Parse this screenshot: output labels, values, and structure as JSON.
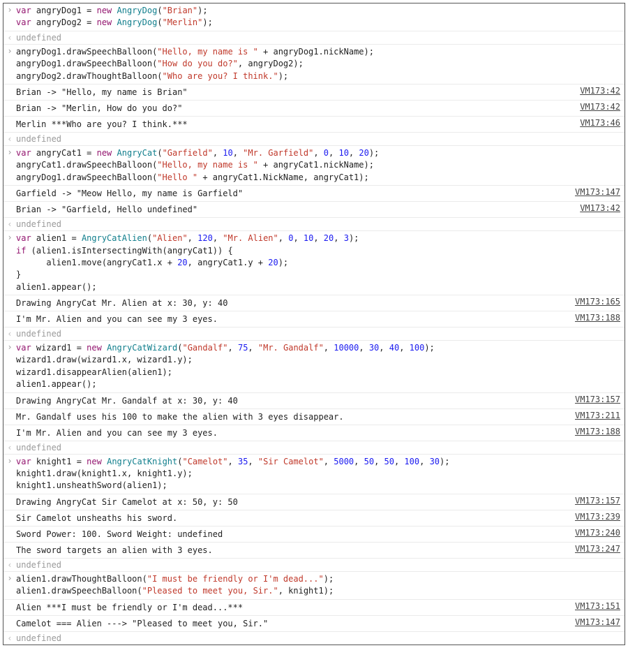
{
  "source": {
    "vm42": "VM173:42",
    "vm46": "VM173:46",
    "vm147": "VM173:147",
    "vm151": "VM173:151",
    "vm157": "VM173:157",
    "vm165": "VM173:165",
    "vm188": "VM173:188",
    "vm211": "VM173:211",
    "vm239": "VM173:239",
    "vm240": "VM173:240",
    "vm247": "VM173:247"
  },
  "undef": "undefined",
  "blk1": {
    "l1a": "var",
    "l1b": " angryDog1 = ",
    "l1c": "new",
    "l1d": " ",
    "l1e": "AngryDog",
    "l1f": "(",
    "l1g": "\"Brian\"",
    "l1h": ");",
    "l2a": "var",
    "l2b": " angryDog2 = ",
    "l2c": "new",
    "l2d": " ",
    "l2e": "AngryDog",
    "l2f": "(",
    "l2g": "\"Merlin\"",
    "l2h": ");"
  },
  "blk2": {
    "l1": "angryDog1.drawSpeechBalloon(",
    "l1s": "\"Hello, my name is \"",
    "l1r": " + angryDog1.nickName);",
    "l2": "angryDog1.drawSpeechBalloon(",
    "l2s": "\"How do you do?\"",
    "l2r": ", angryDog2);",
    "l3": "angryDog2.drawThoughtBalloon(",
    "l3s": "\"Who are you? I think.\"",
    "l3r": ");"
  },
  "out2": {
    "a": "Brian -> \"Hello, my name is Brian\"",
    "b": "Brian -> \"Merlin, How do you do?\"",
    "c": "Merlin ***Who are you? I think.***"
  },
  "blk3": {
    "l1a": "var",
    "l1b": " angryCat1 = ",
    "l1c": "new",
    "l1d": " ",
    "l1e": "AngryCat",
    "l1f": "(",
    "l1g": "\"Garfield\"",
    "l1h": ", ",
    "l1i": "10",
    "l1j": ", ",
    "l1k": "\"Mr. Garfield\"",
    "l1l": ", ",
    "l1m": "0",
    "l1n": ", ",
    "l1o": "10",
    "l1p": ", ",
    "l1q": "20",
    "l1r": ");",
    "l2": "angryCat1.drawSpeechBalloon(",
    "l2s": "\"Hello, my name is \"",
    "l2r": " + angryCat1.nickName);",
    "l3": "angryDog1.drawSpeechBalloon(",
    "l3s": "\"Hello \"",
    "l3r": " + angryCat1.NickName, angryCat1);"
  },
  "out3": {
    "a": "Garfield -> \"Meow Hello, my name is Garfield\"",
    "b": "Brian -> \"Garfield, Hello undefined\""
  },
  "blk4": {
    "l1a": "var",
    "l1b": " alien1 = ",
    "l1c": "AngryCatAlien",
    "l1d": "(",
    "l1e": "\"Alien\"",
    "l1f": ", ",
    "l1g": "120",
    "l1h": ", ",
    "l1i": "\"Mr. Alien\"",
    "l1j": ", ",
    "l1k": "0",
    "l1l": ", ",
    "l1m": "10",
    "l1n": ", ",
    "l1o": "20",
    "l1p": ", ",
    "l1q": "3",
    "l1r": ");",
    "l2a": "if",
    "l2b": " (alien1.isIntersectingWith(angryCat1)) {",
    "l3a": "      alien1.move(angryCat1.x + ",
    "l3b": "20",
    "l3c": ", angryCat1.y + ",
    "l3d": "20",
    "l3e": ");",
    "l4": "}",
    "l5": "alien1.appear();"
  },
  "out4": {
    "a": "Drawing AngryCat Mr. Alien at x: 30, y: 40",
    "b": "I'm Mr. Alien and you can see my 3 eyes."
  },
  "blk5": {
    "l1a": "var",
    "l1b": " wizard1 = ",
    "l1c": "new",
    "l1d": " ",
    "l1e": "AngryCatWizard",
    "l1f": "(",
    "l1g": "\"Gandalf\"",
    "l1h": ", ",
    "l1i": "75",
    "l1j": ", ",
    "l1k": "\"Mr. Gandalf\"",
    "l1l": ", ",
    "l1m": "10000",
    "l1n": ", ",
    "l1o": "30",
    "l1p": ", ",
    "l1q": "40",
    "l1r": ", ",
    "l1s": "100",
    "l1t": ");",
    "l2": "wizard1.draw(wizard1.x, wizard1.y);",
    "l3": "wizard1.disappearAlien(alien1);",
    "l4": "alien1.appear();"
  },
  "out5": {
    "a": "Drawing AngryCat Mr. Gandalf at x: 30, y: 40",
    "b": "Mr. Gandalf uses his 100 to make the alien with 3 eyes disappear.",
    "c": "I'm Mr. Alien and you can see my 3 eyes."
  },
  "blk6": {
    "l1a": "var",
    "l1b": " knight1 = ",
    "l1c": "new",
    "l1d": " ",
    "l1e": "AngryCatKnight",
    "l1f": "(",
    "l1g": "\"Camelot\"",
    "l1h": ", ",
    "l1i": "35",
    "l1j": ", ",
    "l1k": "\"Sir Camelot\"",
    "l1l": ", ",
    "l1m": "5000",
    "l1n": ", ",
    "l1o": "50",
    "l1p": ", ",
    "l1q": "50",
    "l1r": ", ",
    "l1s": "100",
    "l1t": ", ",
    "l1u": "30",
    "l1v": ");",
    "l2": "knight1.draw(knight1.x, knight1.y);",
    "l3": "knight1.unsheathSword(alien1);"
  },
  "out6": {
    "a": "Drawing AngryCat Sir Camelot at x: 50, y: 50",
    "b": "Sir Camelot unsheaths his sword.",
    "c": "Sword Power: 100. Sword Weight: undefined",
    "d": "The sword targets an alien with 3 eyes."
  },
  "blk7": {
    "l1": "alien1.drawThoughtBalloon(",
    "l1s": "\"I must be friendly or I'm dead...\"",
    "l1r": ");",
    "l2": "alien1.drawSpeechBalloon(",
    "l2s": "\"Pleased to meet you, Sir.\"",
    "l2r": ", knight1);"
  },
  "out7": {
    "a": "Alien ***I must be friendly or I'm dead...***",
    "b": "Camelot === Alien ---> \"Pleased to meet you, Sir.\""
  }
}
